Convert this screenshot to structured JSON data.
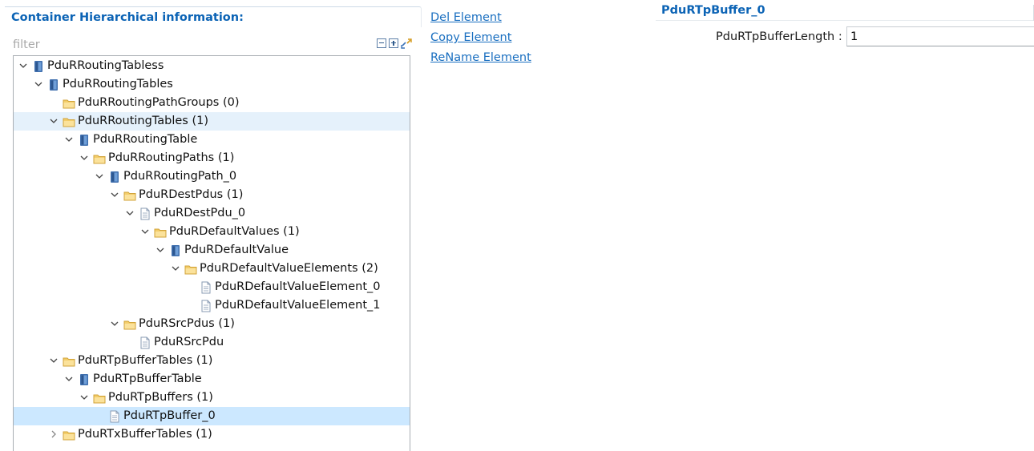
{
  "left_panel": {
    "title": "Container Hierarchical information:",
    "filter_placeholder": "filter",
    "toolbar_icons": [
      "collapse-all-icon",
      "expand-all-icon",
      "link-with-editor-icon"
    ]
  },
  "tree": [
    {
      "label": "PduRRoutingTabless",
      "depth": 0,
      "expand": "open",
      "icon": "module-icon"
    },
    {
      "label": "PduRRoutingTables",
      "depth": 1,
      "expand": "open",
      "icon": "module-icon"
    },
    {
      "label": "PduRRoutingPathGroups (0)",
      "depth": 2,
      "expand": "none",
      "icon": "folder-icon"
    },
    {
      "label": "PduRRoutingTables (1)",
      "depth": 2,
      "expand": "open",
      "icon": "folder-icon",
      "state": "hover"
    },
    {
      "label": "PduRRoutingTable",
      "depth": 3,
      "expand": "open",
      "icon": "module-icon"
    },
    {
      "label": "PduRRoutingPaths (1)",
      "depth": 4,
      "expand": "open",
      "icon": "folder-icon"
    },
    {
      "label": "PduRRoutingPath_0",
      "depth": 5,
      "expand": "open",
      "icon": "module-icon"
    },
    {
      "label": "PduRDestPdus (1)",
      "depth": 6,
      "expand": "open",
      "icon": "folder-icon"
    },
    {
      "label": "PduRDestPdu_0",
      "depth": 7,
      "expand": "open",
      "icon": "document-icon"
    },
    {
      "label": "PduRDefaultValues (1)",
      "depth": 8,
      "expand": "open",
      "icon": "folder-icon"
    },
    {
      "label": "PduRDefaultValue",
      "depth": 9,
      "expand": "open",
      "icon": "module-icon"
    },
    {
      "label": "PduRDefaultValueElements (2)",
      "depth": 10,
      "expand": "open",
      "icon": "folder-icon"
    },
    {
      "label": "PduRDefaultValueElement_0",
      "depth": 11,
      "expand": "none",
      "icon": "document-icon"
    },
    {
      "label": "PduRDefaultValueElement_1",
      "depth": 11,
      "expand": "none",
      "icon": "document-icon"
    },
    {
      "label": "PduRSrcPdus (1)",
      "depth": 6,
      "expand": "open",
      "icon": "folder-icon"
    },
    {
      "label": "PduRSrcPdu",
      "depth": 7,
      "expand": "none",
      "icon": "document-icon"
    },
    {
      "label": "PduRTpBufferTables (1)",
      "depth": 2,
      "expand": "open",
      "icon": "folder-icon"
    },
    {
      "label": "PduRTpBufferTable",
      "depth": 3,
      "expand": "open",
      "icon": "module-icon"
    },
    {
      "label": "PduRTpBuffers (1)",
      "depth": 4,
      "expand": "open",
      "icon": "folder-icon"
    },
    {
      "label": "PduRTpBuffer_0",
      "depth": 5,
      "expand": "none",
      "icon": "document-icon",
      "state": "selected"
    },
    {
      "label": "PduRTxBufferTables (1)",
      "depth": 2,
      "expand": "closed",
      "icon": "folder-icon"
    }
  ],
  "actions": {
    "del": "Del Element",
    "copy": "Copy Element",
    "rename": "ReName Element"
  },
  "detail": {
    "title": "PduRTpBuffer_0",
    "field_label": "PduRTpBufferLength :",
    "field_value": "1"
  },
  "colors": {
    "accent": "#0b63b5",
    "link": "#1a6fc0",
    "selected_row": "#cce8ff",
    "hover_row": "#e5f1fb"
  }
}
